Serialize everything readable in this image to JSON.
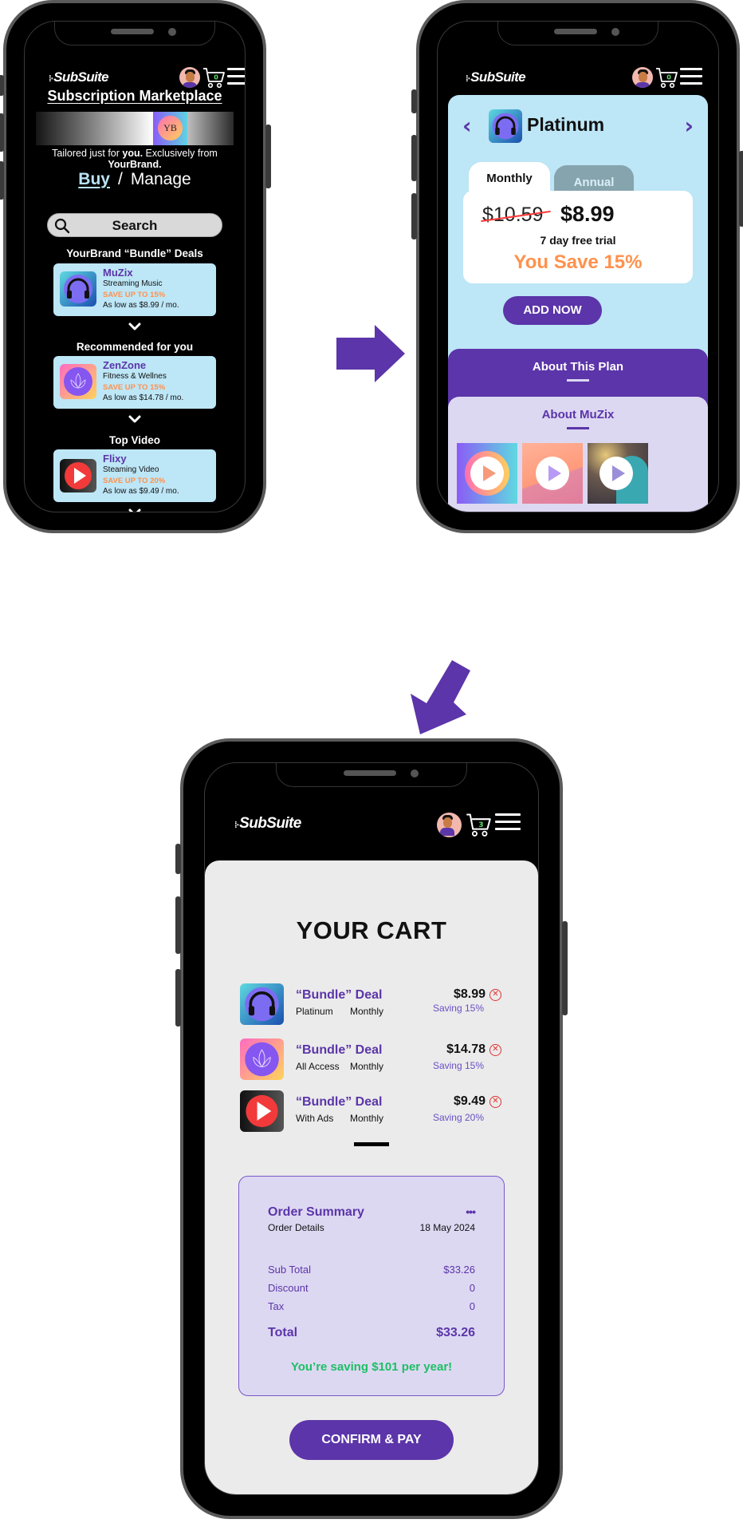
{
  "brand": {
    "name": "SubSuite",
    "accent": "#5b35a9",
    "highlight_orange": "#ff914d",
    "success_green": "#1dbf65",
    "card_blue": "#bde6f6",
    "card_lavender": "#ddd8f2"
  },
  "header": {
    "logo": "SubSuite",
    "logo_mark": "⁞⋅",
    "avatar_label": "User profile",
    "menu_icon": "hamburger-menu-icon",
    "cart_icon": "shopping-cart-icon"
  },
  "screens": {
    "marketplace": {
      "cart_count": "0",
      "title": "Subscription Marketplace",
      "banner_logo_text": "YB",
      "tagline": {
        "part1": "Tailored just for ",
        "bold1": "you.",
        "part2": " Exclusively from ",
        "bold2": "YourBrand."
      },
      "toggle": {
        "buy": "Buy",
        "separator": "/",
        "manage": "Manage"
      },
      "search": {
        "label": "Search",
        "icon": "search-icon"
      },
      "sections": [
        {
          "heading": "YourBrand “Bundle” Deals",
          "deal": {
            "name": "MuZix",
            "category": "Streaming Music",
            "save": "SAVE UP TO 15%",
            "low_price": "As low as $8.99 / mo.",
            "icon": "headphones-icon"
          }
        },
        {
          "heading": "Recommended for you",
          "deal": {
            "name": "ZenZone",
            "category": "Fitness & Wellnes",
            "save": "SAVE UP TO 15%",
            "low_price": "As low as $14.78 / mo.",
            "icon": "lotus-icon"
          }
        },
        {
          "heading": "Top Video",
          "deal": {
            "name": "Flixy",
            "category": "Steaming Video",
            "save": "SAVE UP TO 20%",
            "low_price": "As low as $9.49 / mo.",
            "icon": "play-icon"
          }
        }
      ]
    },
    "plan_detail": {
      "cart_count": "0",
      "plan_name": "Platinum",
      "prev_label": "‹",
      "next_label": "›",
      "tabs": [
        {
          "label": "Monthly",
          "active": true
        },
        {
          "label": "Annual",
          "active": false
        }
      ],
      "old_price": "$10.59",
      "new_price": "$8.99",
      "trial": "7 day free trial",
      "you_save": "You Save 15%",
      "add_button": "ADD NOW",
      "about_plan": "About This Plan",
      "about_service": "About MuZix",
      "videos": [
        {
          "label": "MuZix promo video 1"
        },
        {
          "label": "MuZix promo video 2"
        },
        {
          "label": "MuZix promo video 3"
        }
      ]
    },
    "cart": {
      "cart_count": "3",
      "title": "YOUR CART",
      "items": [
        {
          "title": "“Bundle” Deal",
          "tier": "Platinum",
          "cycle": "Monthly",
          "price": "$8.99",
          "saving": "Saving 15%",
          "icon": "headphones-icon"
        },
        {
          "title": "“Bundle” Deal",
          "tier": "All Access",
          "cycle": "Monthly",
          "price": "$14.78",
          "saving": "Saving 15%",
          "icon": "lotus-icon"
        },
        {
          "title": "“Bundle” Deal",
          "tier": "With Ads",
          "cycle": "Monthly",
          "price": "$9.49",
          "saving": "Saving 20%",
          "icon": "play-icon"
        }
      ],
      "remove_glyph": "✕",
      "summary": {
        "title": "Order Summary",
        "more": "•••",
        "details_label": "Order Details",
        "date": "18 May 2024",
        "lines": [
          {
            "label": "Sub Total",
            "value": "$33.26"
          },
          {
            "label": "Discount",
            "value": "0"
          },
          {
            "label": "Tax",
            "value": "0"
          }
        ],
        "total_label": "Total",
        "total_value": "$33.26",
        "savings_message": "You’re saving $101 per year!"
      },
      "confirm_button": "CONFIRM & PAY"
    }
  }
}
